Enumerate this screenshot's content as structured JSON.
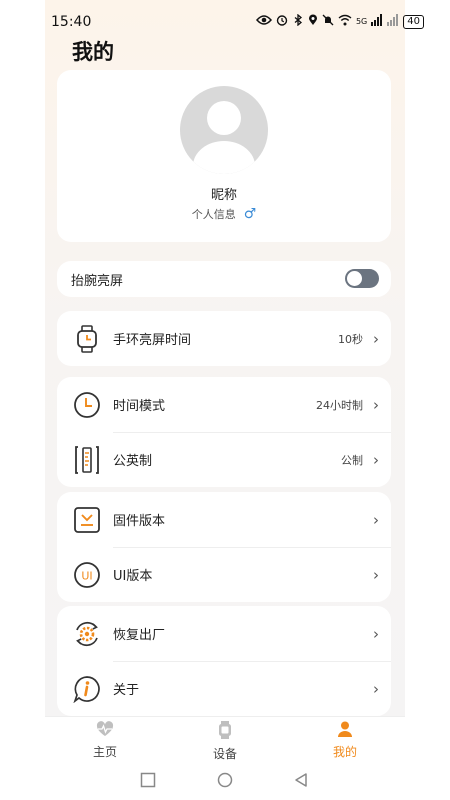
{
  "status_bar": {
    "time": "15:40",
    "network": "5G",
    "battery": "40"
  },
  "page": {
    "title": "我的"
  },
  "profile": {
    "nickname": "昵称",
    "info_label": "个人信息",
    "gender_symbol": "♂"
  },
  "wrist_raise": {
    "label": "抬腕亮屏",
    "enabled": false
  },
  "screen_time": {
    "label": "手环亮屏时间",
    "value": "10秒"
  },
  "settings_group": [
    {
      "label": "时间模式",
      "value": "24小时制"
    },
    {
      "label": "公英制",
      "value": "公制"
    }
  ],
  "version_group": [
    {
      "label": "固件版本",
      "value": ""
    },
    {
      "label": "UI版本",
      "value": ""
    }
  ],
  "misc_group": [
    {
      "label": "恢复出厂",
      "value": ""
    },
    {
      "label": "关于",
      "value": ""
    }
  ],
  "chevron": "›",
  "bottom_nav": [
    {
      "label": "主页",
      "icon": "heartbeat-icon",
      "active": false
    },
    {
      "label": "设备",
      "icon": "watch-icon",
      "active": false
    },
    {
      "label": "我的",
      "icon": "person-icon",
      "active": true
    }
  ],
  "colors": {
    "accent": "#f08a1c",
    "gender": "#3a8bd6",
    "toggle_off": "#6b7480"
  }
}
